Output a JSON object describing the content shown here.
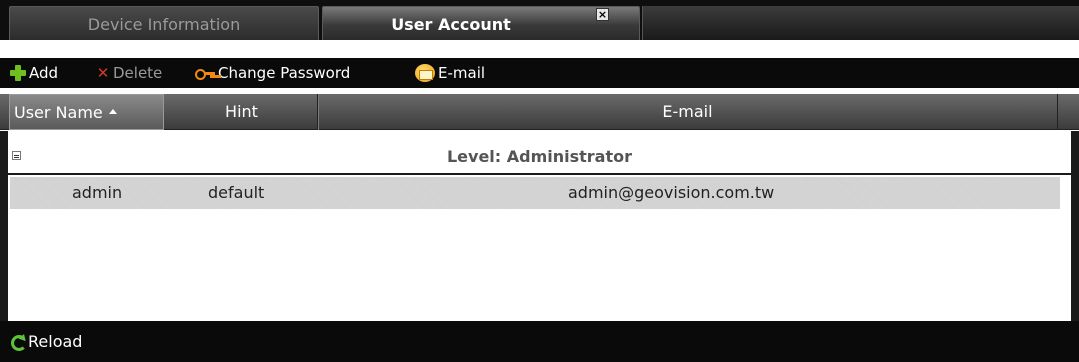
{
  "tabs": [
    {
      "label": "Device Information",
      "active": false
    },
    {
      "label": "User Account",
      "active": true
    }
  ],
  "toolbar": {
    "add_label": "Add",
    "delete_label": "Delete",
    "change_password_label": "Change Password",
    "email_label": "E-mail"
  },
  "columns": {
    "user_name": "User Name",
    "hint": "Hint",
    "email": "E-mail"
  },
  "group": {
    "label": "Level: Administrator"
  },
  "rows": [
    {
      "user_name": "admin",
      "hint": "default",
      "email": "admin@geovision.com.tw"
    }
  ],
  "footer": {
    "reload_label": "Reload"
  },
  "icons": {
    "add": "plus-icon",
    "delete": "x-icon",
    "change_password": "key-icon",
    "email": "mail-icon",
    "reload": "reload-icon",
    "close_tab": "close-icon",
    "collapse": "collapse-icon",
    "sort": "sort-ascending-icon"
  },
  "colors": {
    "accent_green": "#6fbf1f",
    "delete_red": "#d03a2a",
    "key_orange": "#f08a10"
  }
}
